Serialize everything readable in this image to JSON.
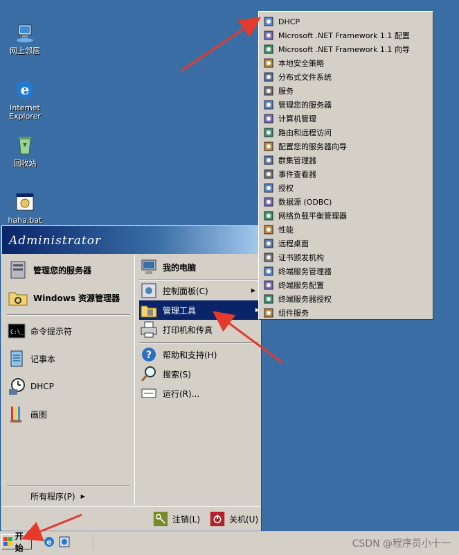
{
  "desktop": {
    "icons": [
      {
        "label": "网上邻居"
      },
      {
        "label": "Internet Explorer"
      },
      {
        "label": "回收站"
      },
      {
        "label": "haha.bat"
      }
    ]
  },
  "start_menu": {
    "user": "Administrator",
    "pinned": [
      {
        "label": "管理您的服务器"
      },
      {
        "label": "Windows 资源管理器"
      }
    ],
    "recent": [
      {
        "label": "命令提示符"
      },
      {
        "label": "记事本"
      },
      {
        "label": "DHCP"
      },
      {
        "label": "画图"
      }
    ],
    "all_programs": "所有程序(P)",
    "right": [
      {
        "label": "我的电脑"
      },
      {
        "label": "控制面板(C)"
      },
      {
        "label": "管理工具"
      },
      {
        "label": "打印机和传真"
      },
      {
        "label": "帮助和支持(H)"
      },
      {
        "label": "搜索(S)"
      },
      {
        "label": "运行(R)..."
      }
    ],
    "logoff": "注销(L)",
    "shutdown": "关机(U)"
  },
  "admin_tools": [
    "DHCP",
    "Microsoft .NET Framework 1.1 配置",
    "Microsoft .NET Framework 1.1 向导",
    "本地安全策略",
    "分布式文件系统",
    "服务",
    "管理您的服务器",
    "计算机管理",
    "路由和远程访问",
    "配置您的服务器向导",
    "群集管理器",
    "事件查看器",
    "授权",
    "数据源 (ODBC)",
    "网络负载平衡管理器",
    "性能",
    "远程桌面",
    "证书颁发机构",
    "终端服务管理器",
    "终端服务配置",
    "终端服务器授权",
    "组件服务"
  ],
  "taskbar": {
    "start": "开始",
    "watermark": "CSDN @程序员小十一"
  },
  "colors": {
    "desktop": "#3a6ea5",
    "highlight": "#0a246a",
    "menu": "#d4d0c8",
    "arrow": "#e53a2b"
  }
}
